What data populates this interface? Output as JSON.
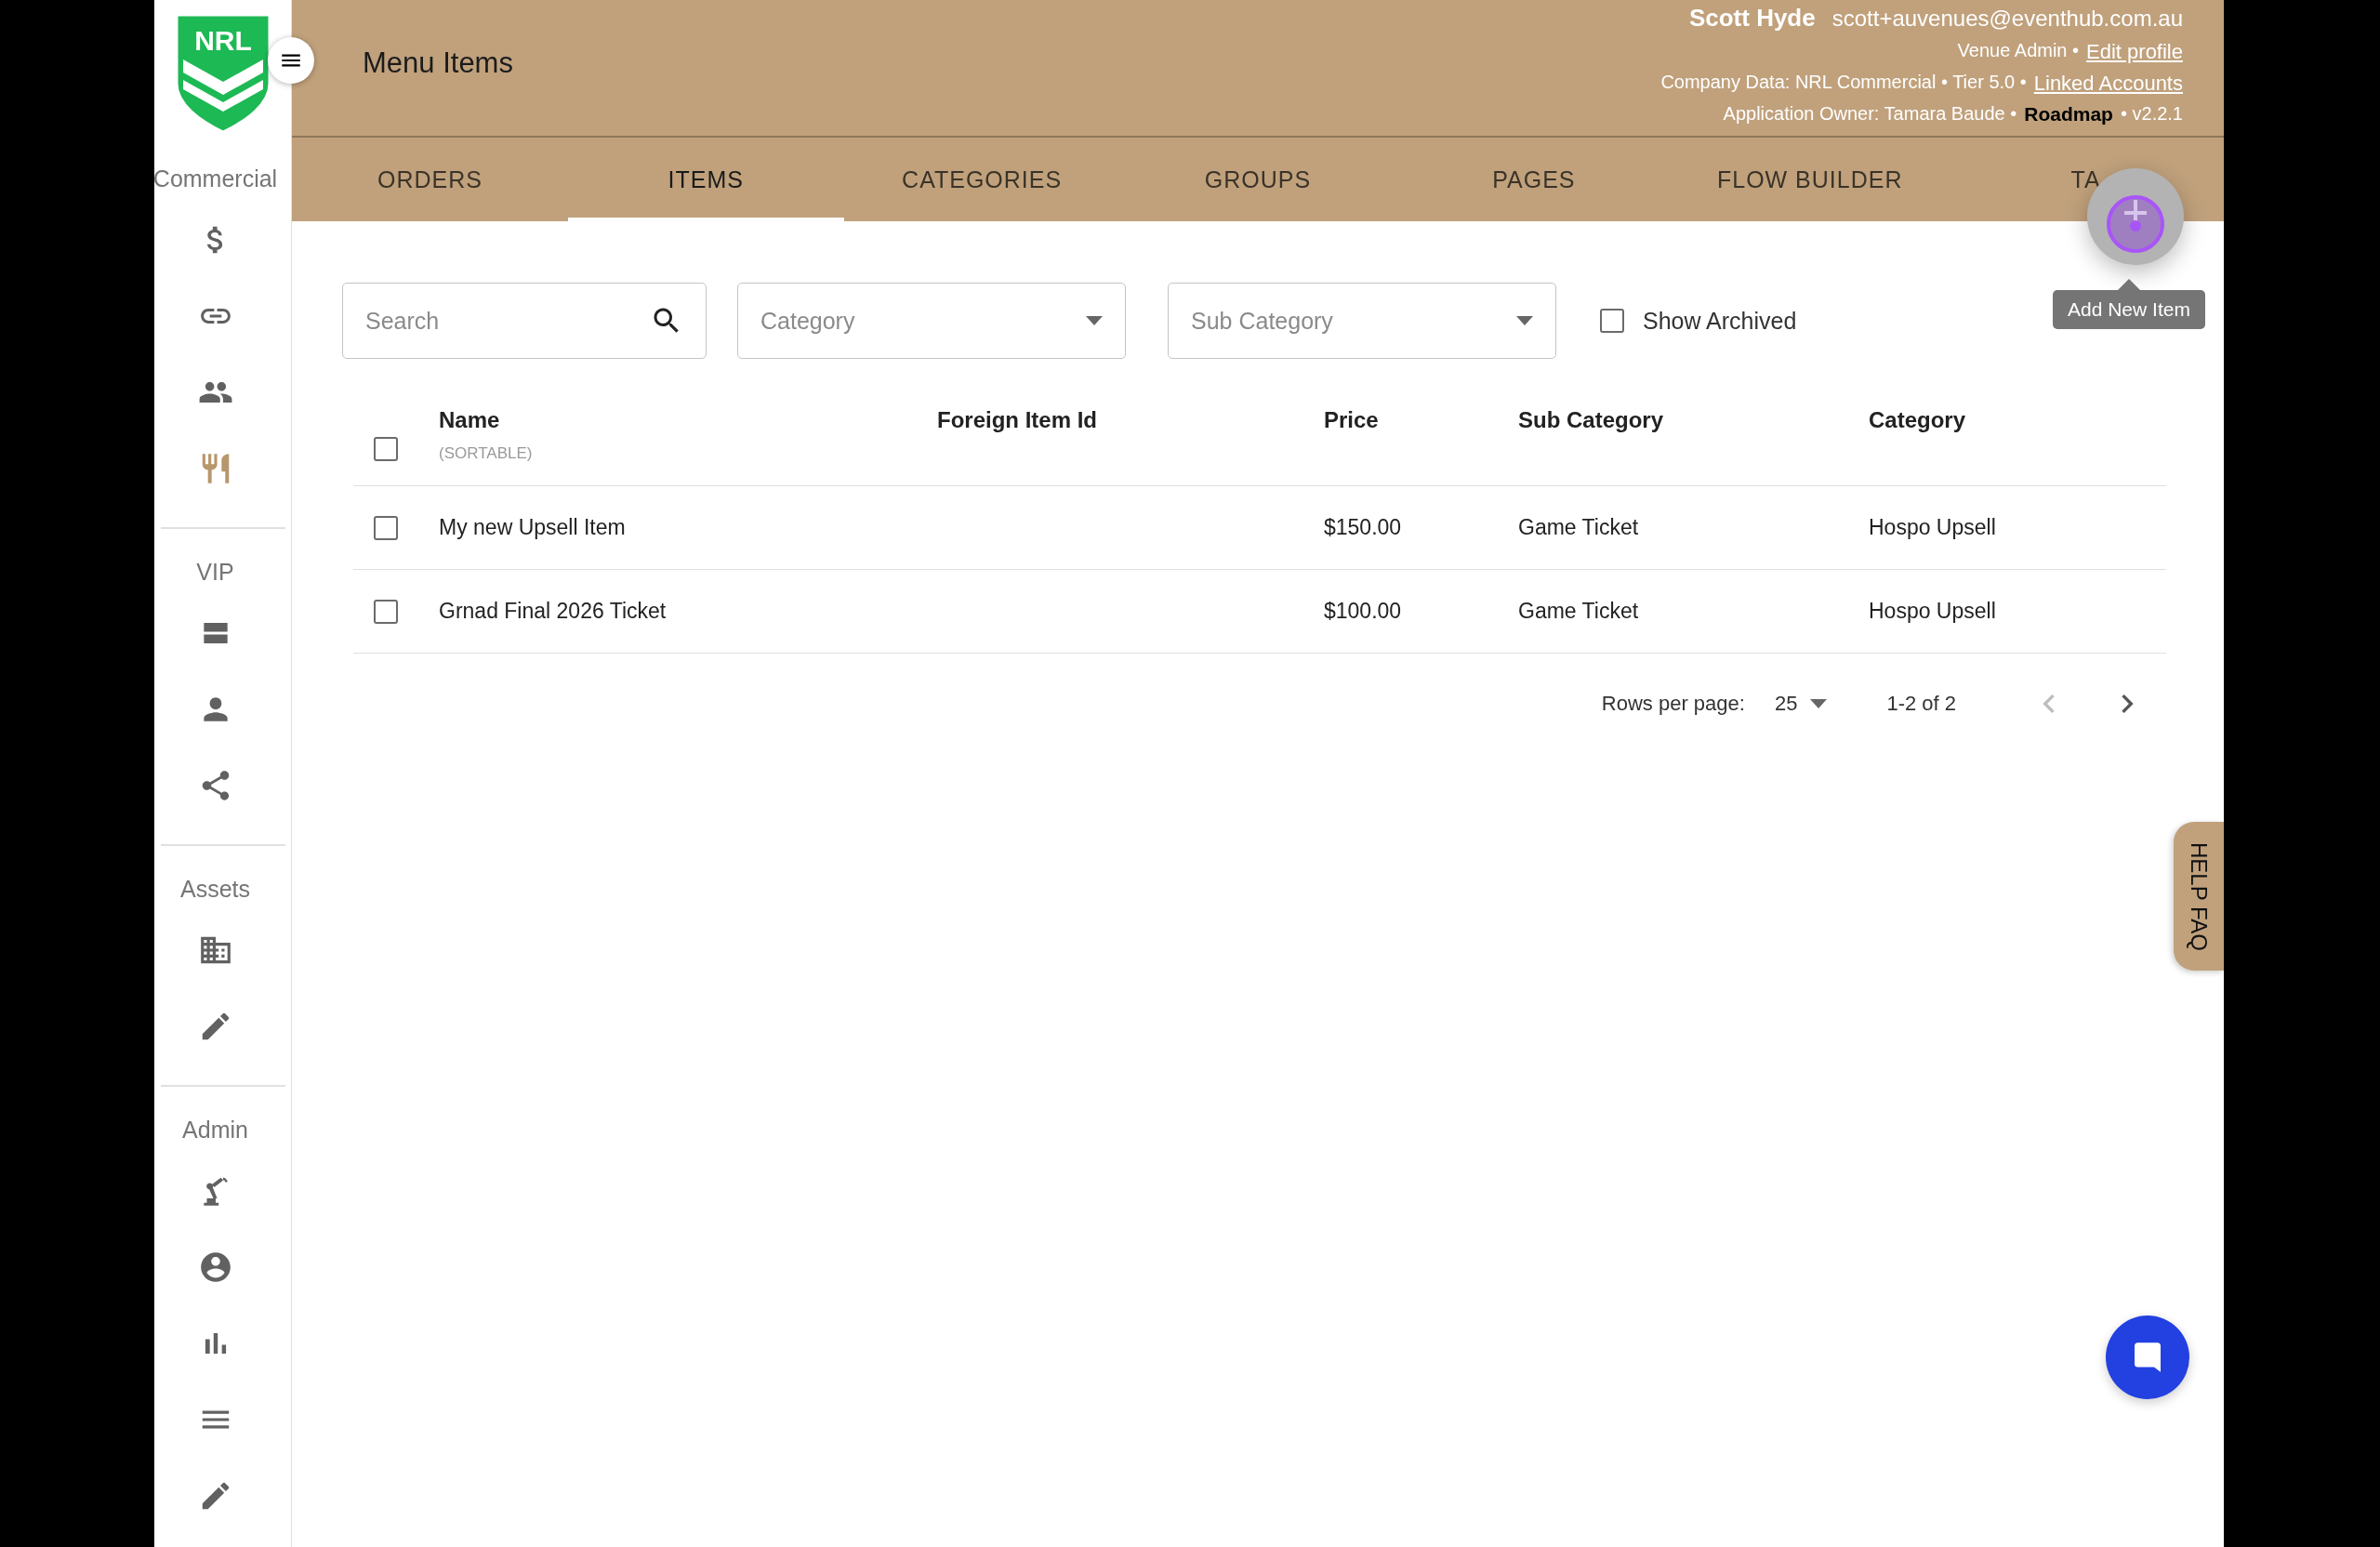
{
  "logo": {
    "text": "NRL"
  },
  "sidebar": {
    "sections": [
      {
        "label": "Commercial",
        "items": [
          {
            "kind": "dollar",
            "selected": false
          },
          {
            "kind": "link",
            "selected": false
          },
          {
            "kind": "people",
            "selected": false
          },
          {
            "kind": "cutlery",
            "selected": true
          }
        ]
      },
      {
        "label": "VIP",
        "items": [
          {
            "kind": "stream",
            "selected": false
          },
          {
            "kind": "person",
            "selected": false
          },
          {
            "kind": "share",
            "selected": false
          }
        ]
      },
      {
        "label": "Assets",
        "items": [
          {
            "kind": "building",
            "selected": false
          },
          {
            "kind": "pencil",
            "selected": false
          }
        ]
      },
      {
        "label": "Admin",
        "items": [
          {
            "kind": "robot",
            "selected": false
          },
          {
            "kind": "account",
            "selected": false
          },
          {
            "kind": "chart",
            "selected": false
          },
          {
            "kind": "lines",
            "selected": false
          },
          {
            "kind": "pencil",
            "selected": false
          }
        ]
      }
    ]
  },
  "header": {
    "title": "Menu Items",
    "user_name": "Scott Hyde",
    "email": "scott+auvenues@eventhub.com.au",
    "lines": [
      [
        {
          "kind": "text",
          "text": "Venue Admin •"
        },
        {
          "kind": "link",
          "text": "Edit profile"
        }
      ],
      [
        {
          "kind": "text",
          "text": "Company Data: NRL Commercial • Tier 5.0 •"
        },
        {
          "kind": "link",
          "text": "Linked Accounts"
        }
      ],
      [
        {
          "kind": "text",
          "text": "Application Owner: Tamara Baude •"
        },
        {
          "kind": "bold",
          "text": "Roadmap"
        },
        {
          "kind": "text",
          "text": "• v2.2.1"
        }
      ]
    ]
  },
  "tabs": [
    {
      "label": "ORDERS",
      "selected": false
    },
    {
      "label": "ITEMS",
      "selected": true
    },
    {
      "label": "CATEGORIES",
      "selected": false
    },
    {
      "label": "GROUPS",
      "selected": false
    },
    {
      "label": "PAGES",
      "selected": false
    },
    {
      "label": "FLOW BUILDER",
      "selected": false
    },
    {
      "label": "TA",
      "selected": false
    }
  ],
  "filters": {
    "search": {
      "placeholder": "Search"
    },
    "category": {
      "placeholder": "Category"
    },
    "sub_category": {
      "placeholder": "Sub Category"
    },
    "show_archived": {
      "label": "Show Archived",
      "checked": false
    }
  },
  "add_button": {
    "tooltip": "Add New Item"
  },
  "table": {
    "select_all": {
      "checked": false
    },
    "columns": [
      {
        "label": "Name",
        "note": "(SORTABLE)"
      },
      {
        "label": "Foreign Item Id"
      },
      {
        "label": "Price"
      },
      {
        "label": "Sub Category"
      },
      {
        "label": "Category"
      }
    ],
    "rows": [
      {
        "selected": false,
        "cells": [
          "My new Upsell Item",
          "",
          "$150.00",
          "Game Ticket",
          "Hospo Upsell"
        ]
      },
      {
        "selected": false,
        "cells": [
          "Grnad Final 2026 Ticket",
          "",
          "$100.00",
          "Game Ticket",
          "Hospo Upsell"
        ]
      }
    ]
  },
  "pagination": {
    "label": "Rows per page:",
    "rows_per_page": "25",
    "range": "1-2 of 2",
    "prev_disabled": true,
    "next_disabled": false
  },
  "help_tab": {
    "label": "HELP FAQ"
  }
}
